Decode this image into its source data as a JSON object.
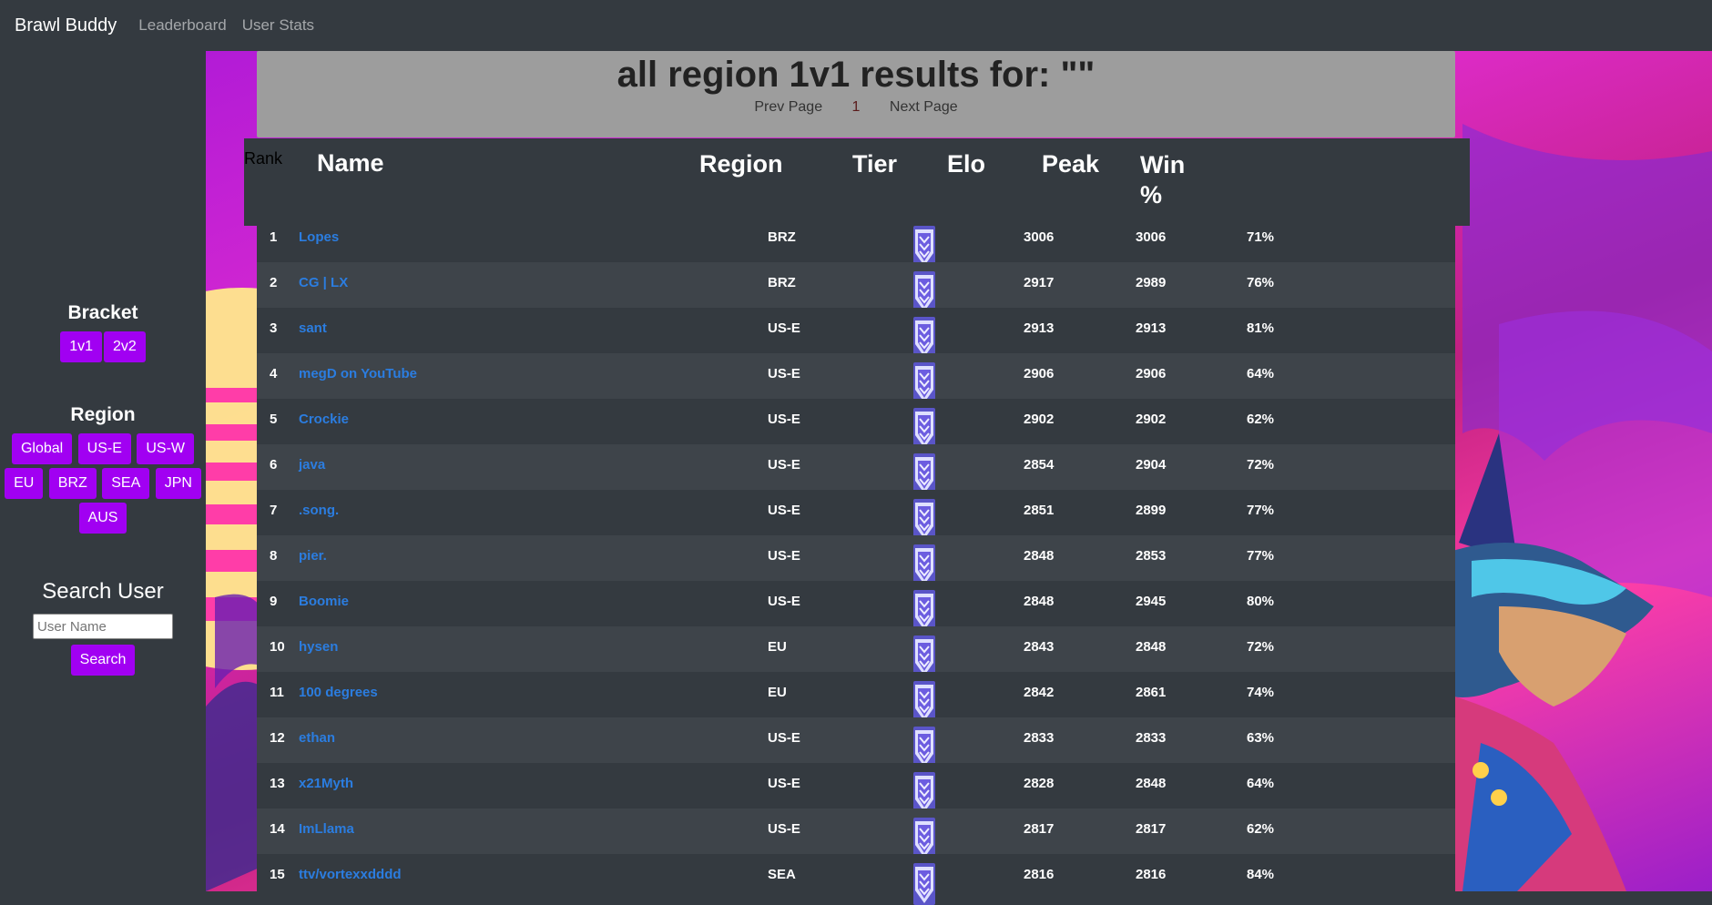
{
  "nav": {
    "brand": "Brawl Buddy",
    "links": [
      "Leaderboard",
      "User Stats"
    ]
  },
  "sidebar": {
    "bracket_heading": "Bracket",
    "brackets": [
      "1v1",
      "2v2"
    ],
    "region_heading": "Region",
    "regions_row1": [
      "Global",
      "US-E",
      "US-W"
    ],
    "regions_row2": [
      "EU",
      "BRZ",
      "SEA",
      "JPN"
    ],
    "regions_row3": [
      "AUS"
    ],
    "search_heading": "Search User",
    "search_placeholder": "User Name",
    "search_button": "Search"
  },
  "header": {
    "title": "all region 1v1 results for: \"\"",
    "prev": "Prev Page",
    "page": "1",
    "next": "Next Page"
  },
  "table": {
    "columns": {
      "rank": "Rank",
      "name": "Name",
      "region": "Region",
      "tier": "Tier",
      "elo": "Elo",
      "peak": "Peak",
      "win": "Win %"
    },
    "rows": [
      {
        "rank": "1",
        "name": "Lopes",
        "region": "BRZ",
        "elo": "3006",
        "peak": "3006",
        "win": "71%"
      },
      {
        "rank": "2",
        "name": "CG | LX",
        "region": "BRZ",
        "elo": "2917",
        "peak": "2989",
        "win": "76%"
      },
      {
        "rank": "3",
        "name": "sant",
        "region": "US-E",
        "elo": "2913",
        "peak": "2913",
        "win": "81%"
      },
      {
        "rank": "4",
        "name": "megD on YouTube",
        "region": "US-E",
        "elo": "2906",
        "peak": "2906",
        "win": "64%"
      },
      {
        "rank": "5",
        "name": "Crockie",
        "region": "US-E",
        "elo": "2902",
        "peak": "2902",
        "win": "62%"
      },
      {
        "rank": "6",
        "name": "java",
        "region": "US-E",
        "elo": "2854",
        "peak": "2904",
        "win": "72%"
      },
      {
        "rank": "7",
        "name": ".song.",
        "region": "US-E",
        "elo": "2851",
        "peak": "2899",
        "win": "77%"
      },
      {
        "rank": "8",
        "name": "pier.",
        "region": "US-E",
        "elo": "2848",
        "peak": "2853",
        "win": "77%"
      },
      {
        "rank": "9",
        "name": "Boomie",
        "region": "US-E",
        "elo": "2848",
        "peak": "2945",
        "win": "80%"
      },
      {
        "rank": "10",
        "name": "hysen",
        "region": "EU",
        "elo": "2843",
        "peak": "2848",
        "win": "72%"
      },
      {
        "rank": "11",
        "name": "100 degrees",
        "region": "EU",
        "elo": "2842",
        "peak": "2861",
        "win": "74%"
      },
      {
        "rank": "12",
        "name": "ethan",
        "region": "US-E",
        "elo": "2833",
        "peak": "2833",
        "win": "63%"
      },
      {
        "rank": "13",
        "name": "x21Myth",
        "region": "US-E",
        "elo": "2828",
        "peak": "2848",
        "win": "64%"
      },
      {
        "rank": "14",
        "name": "ImLlama",
        "region": "US-E",
        "elo": "2817",
        "peak": "2817",
        "win": "62%"
      },
      {
        "rank": "15",
        "name": "ttv/vortexxdddd",
        "region": "SEA",
        "elo": "2816",
        "peak": "2816",
        "win": "84%"
      }
    ],
    "tier_icon": "diamond-tier-icon"
  },
  "colors": {
    "accent": "#a100f2",
    "link": "#2b7de0",
    "panel": "#343a40"
  }
}
